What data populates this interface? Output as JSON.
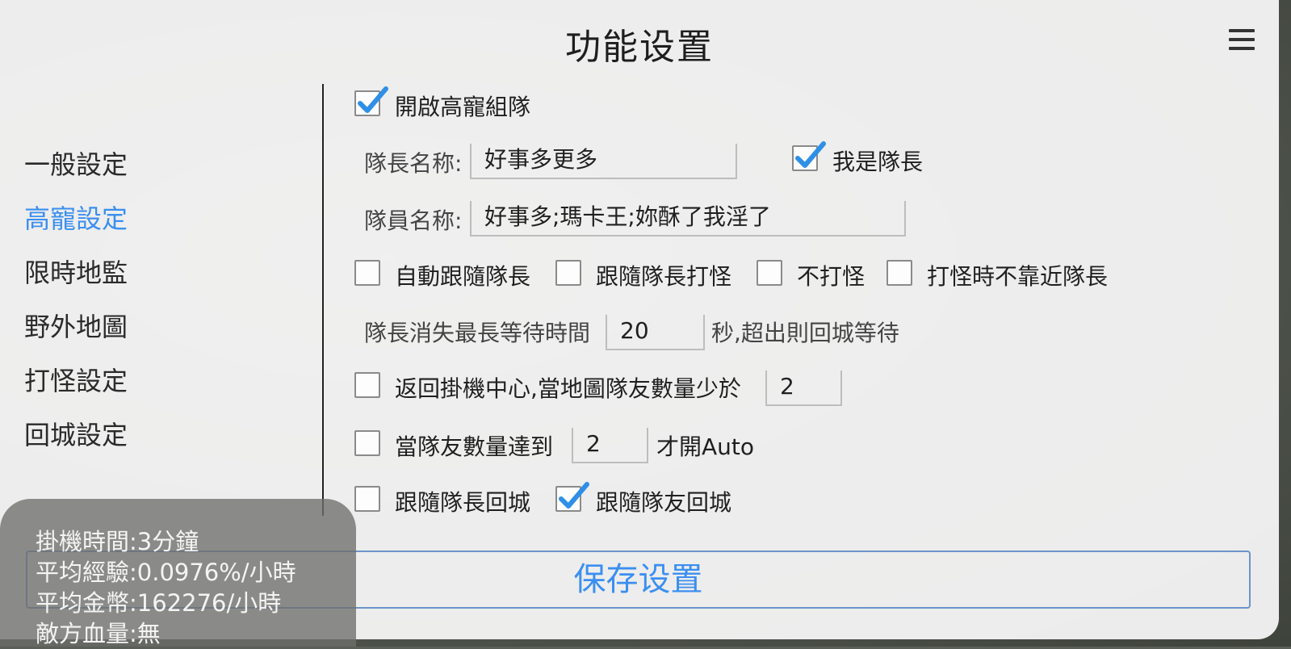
{
  "title": "功能设置",
  "sidebar": {
    "items": [
      {
        "label": "一般設定"
      },
      {
        "label": "高寵設定"
      },
      {
        "label": "限時地監"
      },
      {
        "label": "野外地圖"
      },
      {
        "label": "打怪設定"
      },
      {
        "label": "回城設定"
      }
    ],
    "active_index": 1
  },
  "form": {
    "enable_team": {
      "label": "開啟高寵組隊",
      "checked": true
    },
    "leader_name": {
      "label": "隊長名称:",
      "value": "好事多更多"
    },
    "i_am_leader": {
      "label": "我是隊長",
      "checked": true
    },
    "member_names": {
      "label": "隊員名称:",
      "value": "好事多;瑪卡王;妳酥了我淫了"
    },
    "auto_follow_leader": {
      "label": "自動跟隨隊長",
      "checked": false
    },
    "follow_leader_fight": {
      "label": "跟隨隊長打怪",
      "checked": false
    },
    "no_fight": {
      "label": "不打怪",
      "checked": false
    },
    "no_approach_leader": {
      "label": "打怪時不靠近隊長",
      "checked": false
    },
    "leader_wait": {
      "prefix": "隊長消失最長等待時間",
      "value": "20",
      "suffix": "秒,超出則回城等待"
    },
    "return_center": {
      "label": "返回掛機中心,當地圖隊友數量少於",
      "value": "2",
      "checked": false
    },
    "team_count_auto": {
      "prefix": "當隊友數量達到",
      "value": "2",
      "suffix": "才開Auto",
      "checked": false
    },
    "follow_leader_return": {
      "label": "跟隨隊長回城",
      "checked": false
    },
    "follow_team_return": {
      "label": "跟隨隊友回城",
      "checked": true
    }
  },
  "save_button": "保存设置",
  "stats": {
    "idle_time": "掛機時間:3分鐘",
    "avg_exp": "平均經驗:0.0976%/小時",
    "avg_gold": "平均金幣:162276/小時",
    "enemy_hp": "敵方血量:無"
  },
  "colors": {
    "accent": "#3b8ff0",
    "check": "#2f8fe6"
  },
  "icons": {
    "menu": "menu-icon",
    "check": "check-icon"
  }
}
